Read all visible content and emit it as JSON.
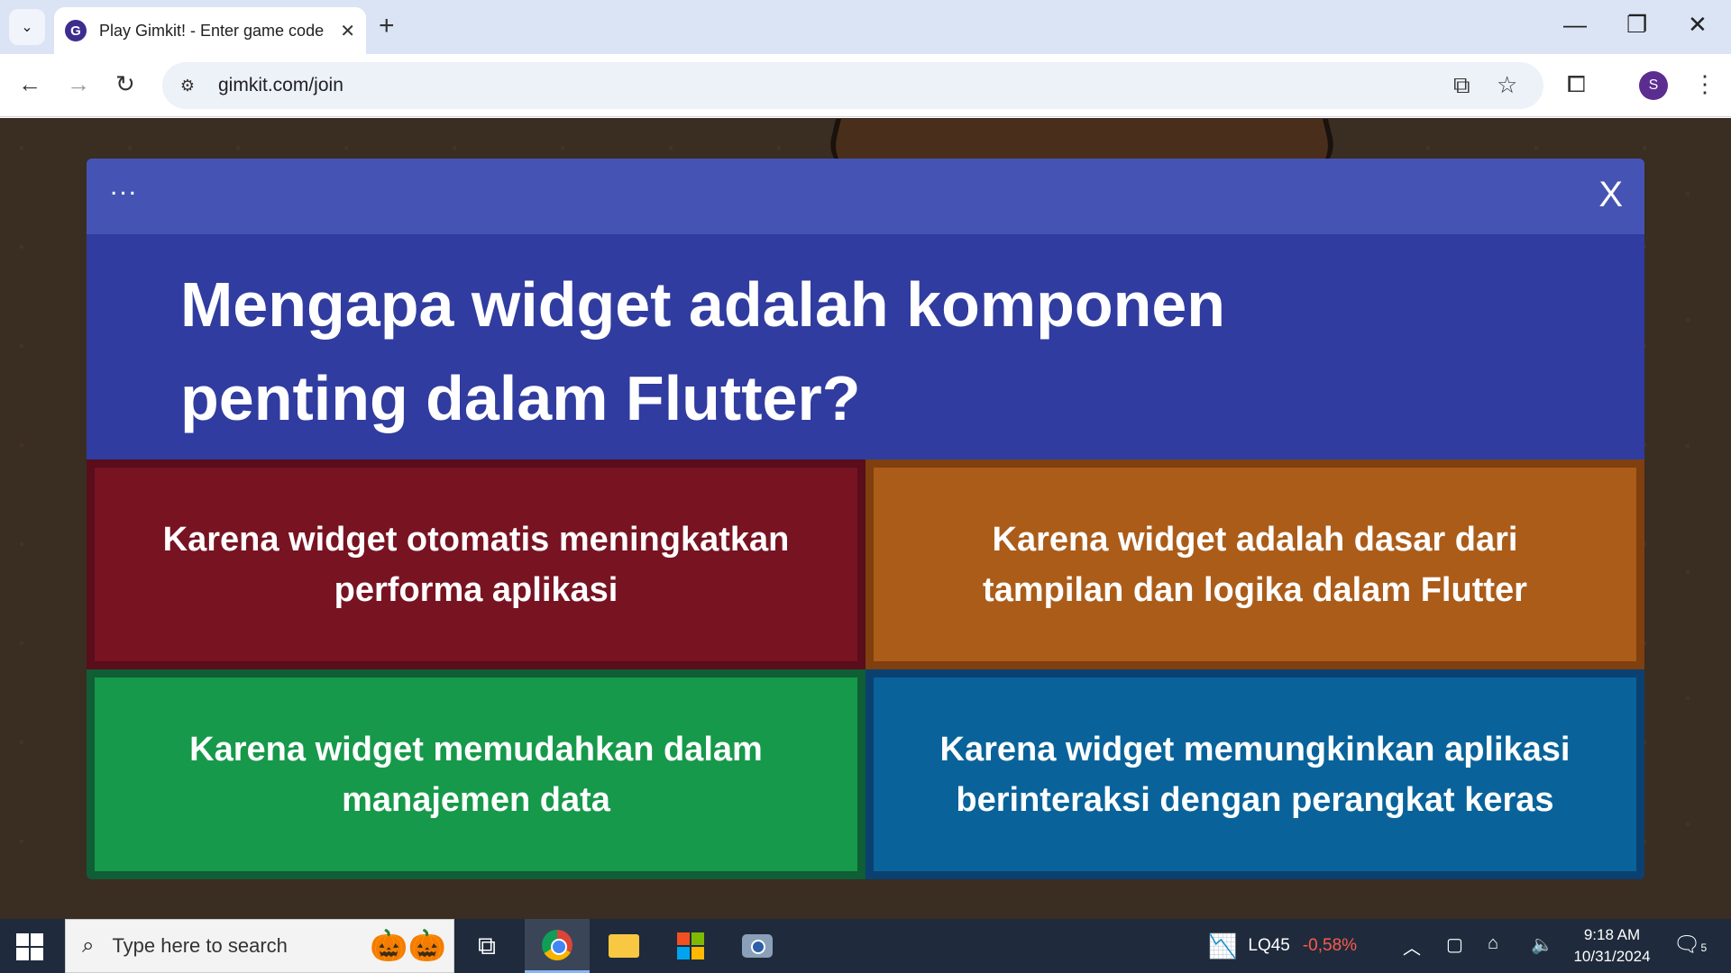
{
  "browser": {
    "tab_title": "Play Gimkit! - Enter game code",
    "favicon_letter": "G",
    "url": "gimkit.com/join",
    "profile_initial": "S"
  },
  "game": {
    "more_label": "...",
    "close_label": "X",
    "question": "Mengapa widget adalah komponen penting dalam Flutter?",
    "answers": [
      {
        "text": "Karena widget otomatis meningkatkan performa aplikasi",
        "color": "#781322"
      },
      {
        "text": "Karena widget adalah dasar dari tampilan dan logika dalam Flutter",
        "color": "#ab5c19"
      },
      {
        "text": "Karena widget memudahkan dalam manajemen data",
        "color": "#16994a"
      },
      {
        "text": "Karena widget memungkinkan aplikasi berinteraksi dengan perangkat keras",
        "color": "#09639a"
      }
    ]
  },
  "taskbar": {
    "search_placeholder": "Type here to search",
    "stock_name": "LQ45",
    "stock_change": "-0,58%",
    "time": "9:18 AM",
    "date": "10/31/2024",
    "notification_count": "5"
  }
}
